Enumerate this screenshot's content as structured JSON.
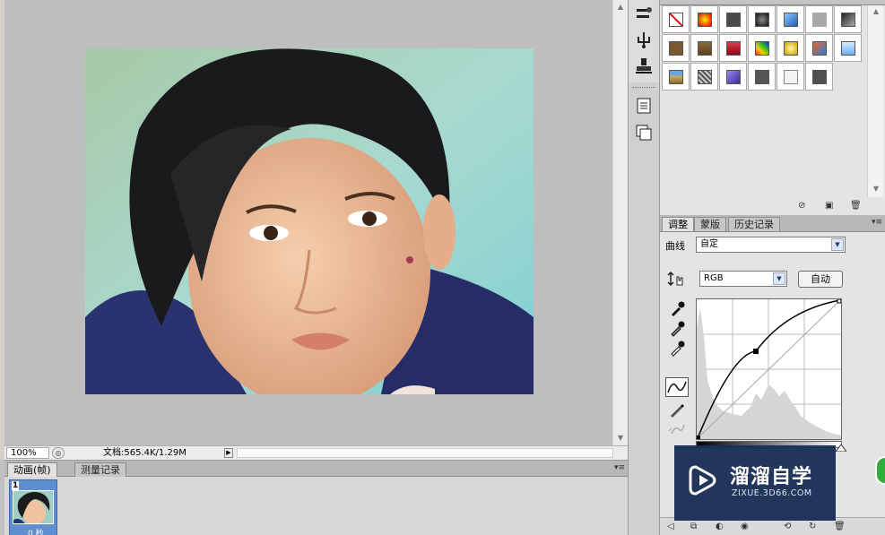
{
  "document": {
    "zoom": "100%",
    "doc_info": "文档:565.4K/1.29M"
  },
  "animation_panel": {
    "tabs": [
      "动画(帧)",
      "测量记录"
    ],
    "frame_number": "1",
    "frame_delay": "0 秒"
  },
  "adjustments_panel": {
    "tabs": [
      "调整",
      "蒙版",
      "历史记录"
    ],
    "preset_label": "曲线",
    "preset_value": "自定",
    "channel_value": "RGB",
    "auto_button": "自动"
  },
  "watermark": {
    "brand": "溜溜自学",
    "url": "ZIXUE.3D66.COM"
  },
  "colors": {
    "panel_bg": "#e4e4e4",
    "canvas_bg": "#bebebe",
    "watermark_bg": "#1a2f55",
    "accent_green": "#2fae3a"
  }
}
